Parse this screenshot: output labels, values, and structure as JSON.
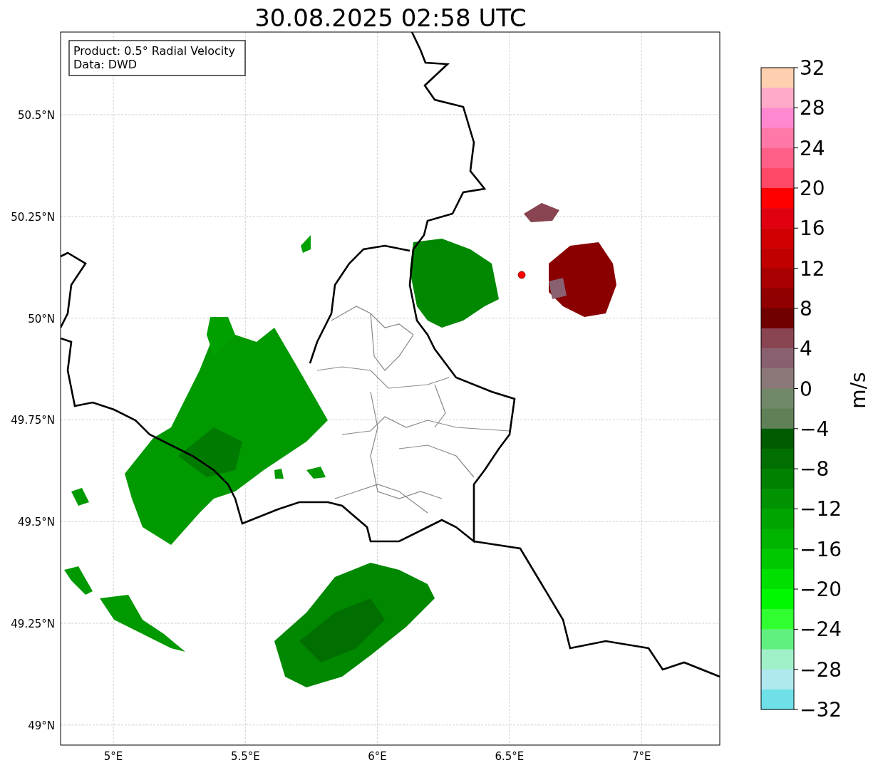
{
  "title": "30.08.2025 02:58 UTC",
  "info_box": [
    "Product: 0.5° Radial Velocity",
    "Data: DWD"
  ],
  "lat_ticks": [
    "50.5°N",
    "50.25°N",
    "50°N",
    "49.75°N",
    "49.5°N",
    "49.25°N",
    "49°N"
  ],
  "lon_ticks": [
    "5°E",
    "5.5°E",
    "6°E",
    "6.5°E",
    "7°E"
  ],
  "colorbar": {
    "label": "m/s",
    "ticks": [
      "32",
      "28",
      "24",
      "20",
      "16",
      "12",
      "8",
      "4",
      "0",
      "−4",
      "−8",
      "−12",
      "−16",
      "−20",
      "−24",
      "−28",
      "−32"
    ],
    "segments": [
      {
        "color": "#ffd0b0"
      },
      {
        "color": "#ffaac8"
      },
      {
        "color": "#ff88d0"
      },
      {
        "color": "#ff78a8"
      },
      {
        "color": "#ff6088"
      },
      {
        "color": "#ff4868"
      },
      {
        "color": "#ff0000"
      },
      {
        "color": "#e00010"
      },
      {
        "color": "#d00000"
      },
      {
        "color": "#c00000"
      },
      {
        "color": "#a80000"
      },
      {
        "color": "#900000"
      },
      {
        "color": "#700000"
      },
      {
        "color": "#884450"
      },
      {
        "color": "#886070"
      },
      {
        "color": "#8a7878"
      },
      {
        "color": "#708868"
      },
      {
        "color": "#608058"
      },
      {
        "color": "#005c00"
      },
      {
        "color": "#006e00"
      },
      {
        "color": "#008000"
      },
      {
        "color": "#009200"
      },
      {
        "color": "#00a400"
      },
      {
        "color": "#00b400"
      },
      {
        "color": "#00c800"
      },
      {
        "color": "#00e000"
      },
      {
        "color": "#00f800"
      },
      {
        "color": "#30ff30"
      },
      {
        "color": "#60f080"
      },
      {
        "color": "#a0f0c8"
      },
      {
        "color": "#b0e8f0"
      },
      {
        "color": "#70e0e8"
      }
    ]
  }
}
